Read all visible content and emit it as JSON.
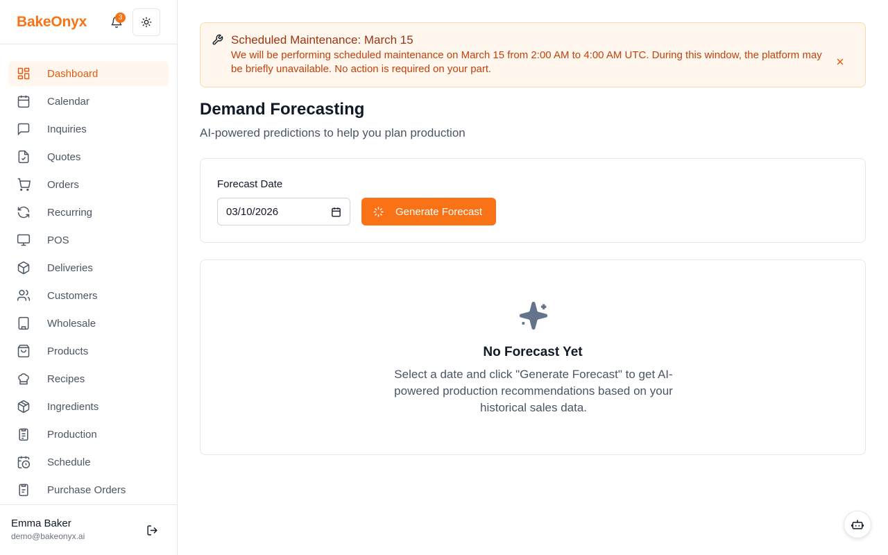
{
  "sidebar": {
    "brand": "BakeOnyx",
    "notification_count": "3",
    "items": [
      {
        "label": "Dashboard",
        "icon": "dashboard-icon",
        "active": true
      },
      {
        "label": "Calendar",
        "icon": "calendar-icon"
      },
      {
        "label": "Inquiries",
        "icon": "message-icon"
      },
      {
        "label": "Quotes",
        "icon": "file-check-icon"
      },
      {
        "label": "Orders",
        "icon": "cart-icon"
      },
      {
        "label": "Recurring",
        "icon": "refresh-icon"
      },
      {
        "label": "POS",
        "icon": "monitor-icon"
      },
      {
        "label": "Deliveries",
        "icon": "package-icon"
      },
      {
        "label": "Customers",
        "icon": "users-icon"
      },
      {
        "label": "Wholesale",
        "icon": "building-icon"
      },
      {
        "label": "Products",
        "icon": "shopping-bag-icon"
      },
      {
        "label": "Recipes",
        "icon": "chef-hat-icon"
      },
      {
        "label": "Ingredients",
        "icon": "box-icon"
      },
      {
        "label": "Production",
        "icon": "clipboard-list-icon"
      },
      {
        "label": "Schedule",
        "icon": "calendar-clock-icon"
      },
      {
        "label": "Purchase Orders",
        "icon": "clipboard-icon"
      }
    ],
    "user": {
      "name": "Emma Baker",
      "email": "demo@bakeonyx.ai"
    }
  },
  "banner": {
    "title": "Scheduled Maintenance: March 15",
    "text": "We will be performing scheduled maintenance on March 15 from 2:00 AM to 4:00 AM UTC. During this window, the platform may be briefly unavailable. No action is required on your part."
  },
  "page": {
    "title": "Demand Forecasting",
    "subtitle": "AI-powered predictions to help you plan production"
  },
  "form": {
    "date_label": "Forecast Date",
    "date_value": "03/10/2026",
    "generate_label": "Generate Forecast"
  },
  "empty": {
    "title": "No Forecast Yet",
    "text": "Select a date and click \"Generate Forecast\" to get AI-powered production recommendations based on your historical sales data."
  },
  "colors": {
    "accent": "#f97316",
    "banner_bg": "#fff7ed",
    "banner_text": "#c2410c"
  }
}
